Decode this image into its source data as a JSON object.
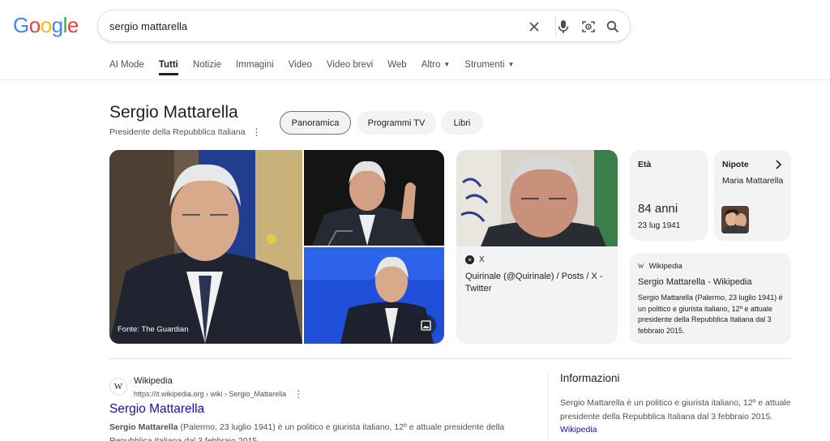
{
  "logo": {
    "letters": [
      "G",
      "o",
      "o",
      "g",
      "l",
      "e"
    ],
    "colors": [
      "#4285F4",
      "#EA4335",
      "#FBBC05",
      "#4285F4",
      "#34A853",
      "#EA4335"
    ]
  },
  "search": {
    "query": "sergio mattarella"
  },
  "tabs": [
    {
      "label": "AI Mode"
    },
    {
      "label": "Tutti",
      "active": true
    },
    {
      "label": "Notizie"
    },
    {
      "label": "Immagini"
    },
    {
      "label": "Video"
    },
    {
      "label": "Video brevi"
    },
    {
      "label": "Web"
    },
    {
      "label": "Altro",
      "dropdown": true
    },
    {
      "label": "Strumenti",
      "dropdown": true
    }
  ],
  "entity": {
    "title": "Sergio Mattarella",
    "subtitle": "Presidente della Repubblica Italiana",
    "chips": [
      "Panoramica",
      "Programmi TV",
      "Libri"
    ]
  },
  "images": {
    "main_caption": "Fonte: The Guardian"
  },
  "x_card": {
    "source": "X",
    "title": "Quirinale (@Quirinale) / Posts / X - Twitter"
  },
  "age_card": {
    "label": "Età",
    "value": "84 anni",
    "date": "23 lug 1941"
  },
  "nephew_card": {
    "label": "Nipote",
    "name": "Maria Mattarella"
  },
  "wiki_card": {
    "source": "Wikipedia",
    "title": "Sergio Mattarella - Wikipedia",
    "text": "Sergio Mattarella (Palermo, 23 luglio 1941) è un politico e giurista italiano, 12º e attuale presidente della Repubblica Italiana dal 3 febbraio 2015."
  },
  "result": {
    "site": "Wikipedia",
    "url": "https://it.wikipedia.org › wiki › Sergio_Mattarella",
    "title": "Sergio Mattarella",
    "snippet_bold": "Sergio Mattarella",
    "snippet_rest": " (Palermo, 23 luglio 1941) è un politico e giurista italiano, 12º e attuale presidente della Repubblica Italiana dal 3 febbraio 2015."
  },
  "info": {
    "title": "Informazioni",
    "text": "Sergio Mattarella è un politico e giurista italiano, 12º e attuale presidente della Repubblica Italiana dal 3 febbraio 2015. ",
    "link": "Wikipedia"
  }
}
